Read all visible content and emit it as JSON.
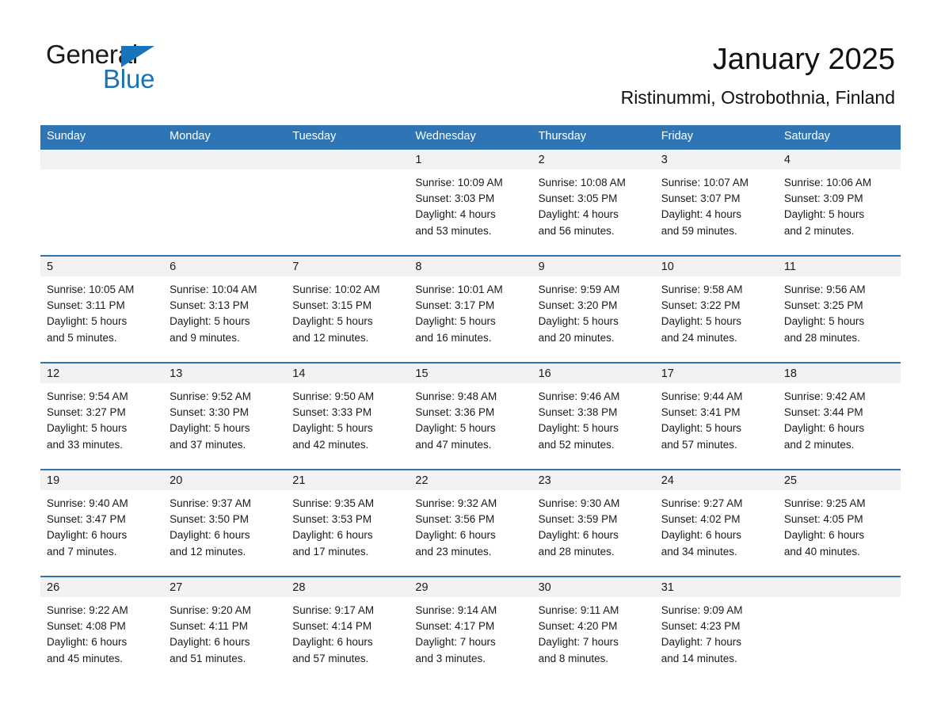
{
  "logo": {
    "primary_text": "General",
    "secondary_text": "Blue",
    "primary_color": "#1a1a1a",
    "secondary_color": "#1874BA"
  },
  "header": {
    "title": "January 2025",
    "subtitle": "Ristinummi, Ostrobothnia, Finland"
  },
  "theme": {
    "header_bg": "#2E75B6",
    "header_text": "#FFFFFF",
    "date_band_bg": "#F2F2F2",
    "cell_bg": "#FFFFFF",
    "row_border": "#2E75B6",
    "text": "#1a1a1a"
  },
  "calendar": {
    "weekdays": [
      "Sunday",
      "Monday",
      "Tuesday",
      "Wednesday",
      "Thursday",
      "Friday",
      "Saturday"
    ],
    "weeks": [
      [
        {
          "date": "",
          "lines": []
        },
        {
          "date": "",
          "lines": []
        },
        {
          "date": "",
          "lines": []
        },
        {
          "date": "1",
          "lines": [
            "Sunrise: 10:09 AM",
            "Sunset: 3:03 PM",
            "Daylight: 4 hours",
            "and 53 minutes."
          ]
        },
        {
          "date": "2",
          "lines": [
            "Sunrise: 10:08 AM",
            "Sunset: 3:05 PM",
            "Daylight: 4 hours",
            "and 56 minutes."
          ]
        },
        {
          "date": "3",
          "lines": [
            "Sunrise: 10:07 AM",
            "Sunset: 3:07 PM",
            "Daylight: 4 hours",
            "and 59 minutes."
          ]
        },
        {
          "date": "4",
          "lines": [
            "Sunrise: 10:06 AM",
            "Sunset: 3:09 PM",
            "Daylight: 5 hours",
            "and 2 minutes."
          ]
        }
      ],
      [
        {
          "date": "5",
          "lines": [
            "Sunrise: 10:05 AM",
            "Sunset: 3:11 PM",
            "Daylight: 5 hours",
            "and 5 minutes."
          ]
        },
        {
          "date": "6",
          "lines": [
            "Sunrise: 10:04 AM",
            "Sunset: 3:13 PM",
            "Daylight: 5 hours",
            "and 9 minutes."
          ]
        },
        {
          "date": "7",
          "lines": [
            "Sunrise: 10:02 AM",
            "Sunset: 3:15 PM",
            "Daylight: 5 hours",
            "and 12 minutes."
          ]
        },
        {
          "date": "8",
          "lines": [
            "Sunrise: 10:01 AM",
            "Sunset: 3:17 PM",
            "Daylight: 5 hours",
            "and 16 minutes."
          ]
        },
        {
          "date": "9",
          "lines": [
            "Sunrise: 9:59 AM",
            "Sunset: 3:20 PM",
            "Daylight: 5 hours",
            "and 20 minutes."
          ]
        },
        {
          "date": "10",
          "lines": [
            "Sunrise: 9:58 AM",
            "Sunset: 3:22 PM",
            "Daylight: 5 hours",
            "and 24 minutes."
          ]
        },
        {
          "date": "11",
          "lines": [
            "Sunrise: 9:56 AM",
            "Sunset: 3:25 PM",
            "Daylight: 5 hours",
            "and 28 minutes."
          ]
        }
      ],
      [
        {
          "date": "12",
          "lines": [
            "Sunrise: 9:54 AM",
            "Sunset: 3:27 PM",
            "Daylight: 5 hours",
            "and 33 minutes."
          ]
        },
        {
          "date": "13",
          "lines": [
            "Sunrise: 9:52 AM",
            "Sunset: 3:30 PM",
            "Daylight: 5 hours",
            "and 37 minutes."
          ]
        },
        {
          "date": "14",
          "lines": [
            "Sunrise: 9:50 AM",
            "Sunset: 3:33 PM",
            "Daylight: 5 hours",
            "and 42 minutes."
          ]
        },
        {
          "date": "15",
          "lines": [
            "Sunrise: 9:48 AM",
            "Sunset: 3:36 PM",
            "Daylight: 5 hours",
            "and 47 minutes."
          ]
        },
        {
          "date": "16",
          "lines": [
            "Sunrise: 9:46 AM",
            "Sunset: 3:38 PM",
            "Daylight: 5 hours",
            "and 52 minutes."
          ]
        },
        {
          "date": "17",
          "lines": [
            "Sunrise: 9:44 AM",
            "Sunset: 3:41 PM",
            "Daylight: 5 hours",
            "and 57 minutes."
          ]
        },
        {
          "date": "18",
          "lines": [
            "Sunrise: 9:42 AM",
            "Sunset: 3:44 PM",
            "Daylight: 6 hours",
            "and 2 minutes."
          ]
        }
      ],
      [
        {
          "date": "19",
          "lines": [
            "Sunrise: 9:40 AM",
            "Sunset: 3:47 PM",
            "Daylight: 6 hours",
            "and 7 minutes."
          ]
        },
        {
          "date": "20",
          "lines": [
            "Sunrise: 9:37 AM",
            "Sunset: 3:50 PM",
            "Daylight: 6 hours",
            "and 12 minutes."
          ]
        },
        {
          "date": "21",
          "lines": [
            "Sunrise: 9:35 AM",
            "Sunset: 3:53 PM",
            "Daylight: 6 hours",
            "and 17 minutes."
          ]
        },
        {
          "date": "22",
          "lines": [
            "Sunrise: 9:32 AM",
            "Sunset: 3:56 PM",
            "Daylight: 6 hours",
            "and 23 minutes."
          ]
        },
        {
          "date": "23",
          "lines": [
            "Sunrise: 9:30 AM",
            "Sunset: 3:59 PM",
            "Daylight: 6 hours",
            "and 28 minutes."
          ]
        },
        {
          "date": "24",
          "lines": [
            "Sunrise: 9:27 AM",
            "Sunset: 4:02 PM",
            "Daylight: 6 hours",
            "and 34 minutes."
          ]
        },
        {
          "date": "25",
          "lines": [
            "Sunrise: 9:25 AM",
            "Sunset: 4:05 PM",
            "Daylight: 6 hours",
            "and 40 minutes."
          ]
        }
      ],
      [
        {
          "date": "26",
          "lines": [
            "Sunrise: 9:22 AM",
            "Sunset: 4:08 PM",
            "Daylight: 6 hours",
            "and 45 minutes."
          ]
        },
        {
          "date": "27",
          "lines": [
            "Sunrise: 9:20 AM",
            "Sunset: 4:11 PM",
            "Daylight: 6 hours",
            "and 51 minutes."
          ]
        },
        {
          "date": "28",
          "lines": [
            "Sunrise: 9:17 AM",
            "Sunset: 4:14 PM",
            "Daylight: 6 hours",
            "and 57 minutes."
          ]
        },
        {
          "date": "29",
          "lines": [
            "Sunrise: 9:14 AM",
            "Sunset: 4:17 PM",
            "Daylight: 7 hours",
            "and 3 minutes."
          ]
        },
        {
          "date": "30",
          "lines": [
            "Sunrise: 9:11 AM",
            "Sunset: 4:20 PM",
            "Daylight: 7 hours",
            "and 8 minutes."
          ]
        },
        {
          "date": "31",
          "lines": [
            "Sunrise: 9:09 AM",
            "Sunset: 4:23 PM",
            "Daylight: 7 hours",
            "and 14 minutes."
          ]
        },
        {
          "date": "",
          "lines": []
        }
      ]
    ]
  }
}
